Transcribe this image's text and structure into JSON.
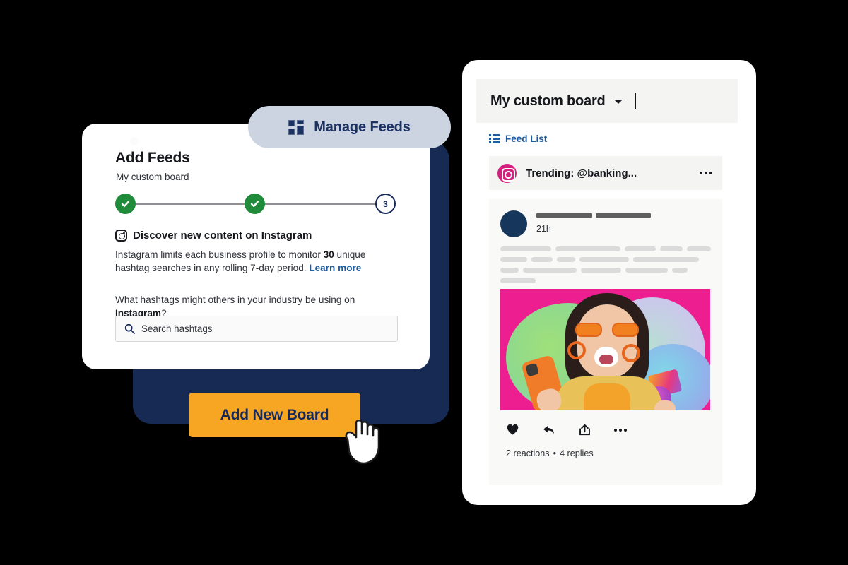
{
  "theme": {
    "navy": "#172a54",
    "accent_orange": "#f6a623",
    "link_blue": "#1d5c9e",
    "step_green": "#208c3b",
    "instagram_pink": "#d61f7e",
    "pill_gray": "#ccd4e1",
    "page_background": "#000000"
  },
  "manage_feeds_button": {
    "label": "Manage Feeds",
    "icon": "grid-icon"
  },
  "add_feeds_card": {
    "title": "Add Feeds",
    "subtitle": "My custom board",
    "stepper": {
      "steps": [
        {
          "state": "done",
          "label": ""
        },
        {
          "state": "done",
          "label": ""
        },
        {
          "state": "current",
          "label": "3"
        }
      ]
    },
    "section": {
      "icon": "instagram-icon",
      "heading": "Discover new content on Instagram",
      "limit_text_prefix": "Instagram limits each business profile to monitor ",
      "limit_number": "30",
      "limit_text_suffix": " unique hashtag searches in any rolling 7-day period. ",
      "learn_more": "Learn more",
      "question_prefix": "What hashtags might others in your industry be using on ",
      "question_network": "Instagram",
      "question_suffix": "?"
    },
    "search": {
      "placeholder": "Search hashtags",
      "value": "",
      "icon": "search-icon"
    }
  },
  "add_new_board_button": {
    "label": "Add New Board"
  },
  "cursor": {
    "type": "pointing-hand-cursor"
  },
  "board_panel": {
    "header": {
      "title": "My custom board",
      "dropdown_icon": "chevron-down-icon",
      "caret": "|"
    },
    "feed_list": {
      "icon": "list-icon",
      "label": "Feed List"
    },
    "feeds": [
      {
        "icon": "instagram-icon",
        "label": "Trending: @banking...",
        "menu_icon": "more-horizontal-icon"
      }
    ],
    "post": {
      "author_placeholder": true,
      "timestamp": "21h",
      "image": "woman-with-orange-phone-photo",
      "actions": [
        {
          "name": "like",
          "icon": "heart-icon"
        },
        {
          "name": "reply",
          "icon": "reply-arrow-icon"
        },
        {
          "name": "share",
          "icon": "share-box-icon"
        },
        {
          "name": "more",
          "icon": "more-horizontal-icon"
        }
      ],
      "reactions": "2 reactions",
      "separator": "•",
      "replies": "4 replies"
    }
  }
}
